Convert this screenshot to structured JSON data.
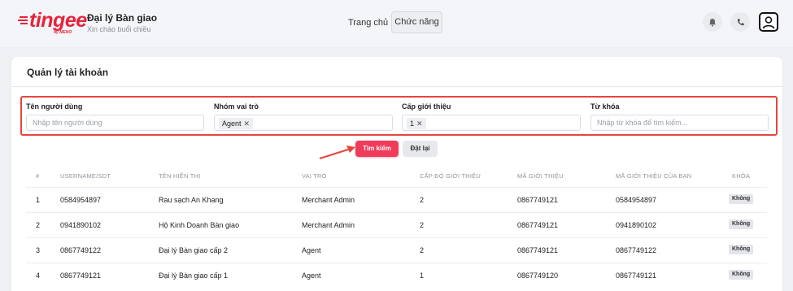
{
  "header": {
    "logo_text": "tingee",
    "logo_sub": "by MENO",
    "brand_title": "Đại lý Bàn giao",
    "brand_sub": "Xin chào buổi chiều",
    "nav": {
      "home": "Trang chủ",
      "functions": "Chức năng"
    },
    "icons": [
      "bell-icon",
      "phone-icon",
      "user-avatar-icon"
    ]
  },
  "page": {
    "title": "Quản lý tài khoản",
    "filters": {
      "username_label": "Tên người dùng",
      "username_placeholder": "Nhập tên người dùng",
      "role_label": "Nhóm vai trò",
      "role_tag": "Agent",
      "level_label": "Cấp giới thiệu",
      "level_tag": "1",
      "keyword_label": "Từ khóa",
      "keyword_placeholder": "Nhập từ khóa để tìm kiếm..."
    },
    "buttons": {
      "search": "Tìm kiếm",
      "reset": "Đặt lại"
    }
  },
  "table": {
    "headers": [
      "#",
      "USERNAME/SDT",
      "TÊN HIỂN THỊ",
      "VAI TRÒ",
      "CẤP ĐỘ GIỚI THIỆU",
      "MÃ GIỚI THIỆU",
      "MÃ GIỚI THIỆU CỦA BẠN",
      "KHÓA"
    ],
    "rows": [
      [
        "1",
        "0584954897",
        "Rau sạch An Khang",
        "Merchant Admin",
        "2",
        "0867749121",
        "0584954897",
        "Không"
      ],
      [
        "2",
        "0941890102",
        "Hộ Kinh Doanh Bàn giao",
        "Merchant Admin",
        "2",
        "0867749121",
        "0941890102",
        "Không"
      ],
      [
        "3",
        "0867749122",
        "Đại lý Bàn giao cấp 2",
        "Agent",
        "2",
        "0867749121",
        "0867749122",
        "Không"
      ],
      [
        "4",
        "0867749121",
        "Đại lý Bàn giao cấp 1",
        "Agent",
        "1",
        "0867749120",
        "0867749121",
        "Không"
      ]
    ]
  },
  "colors": {
    "brand": "#e8233b",
    "primary_button": "#f03b5a",
    "highlight_border": "#e8453c"
  }
}
